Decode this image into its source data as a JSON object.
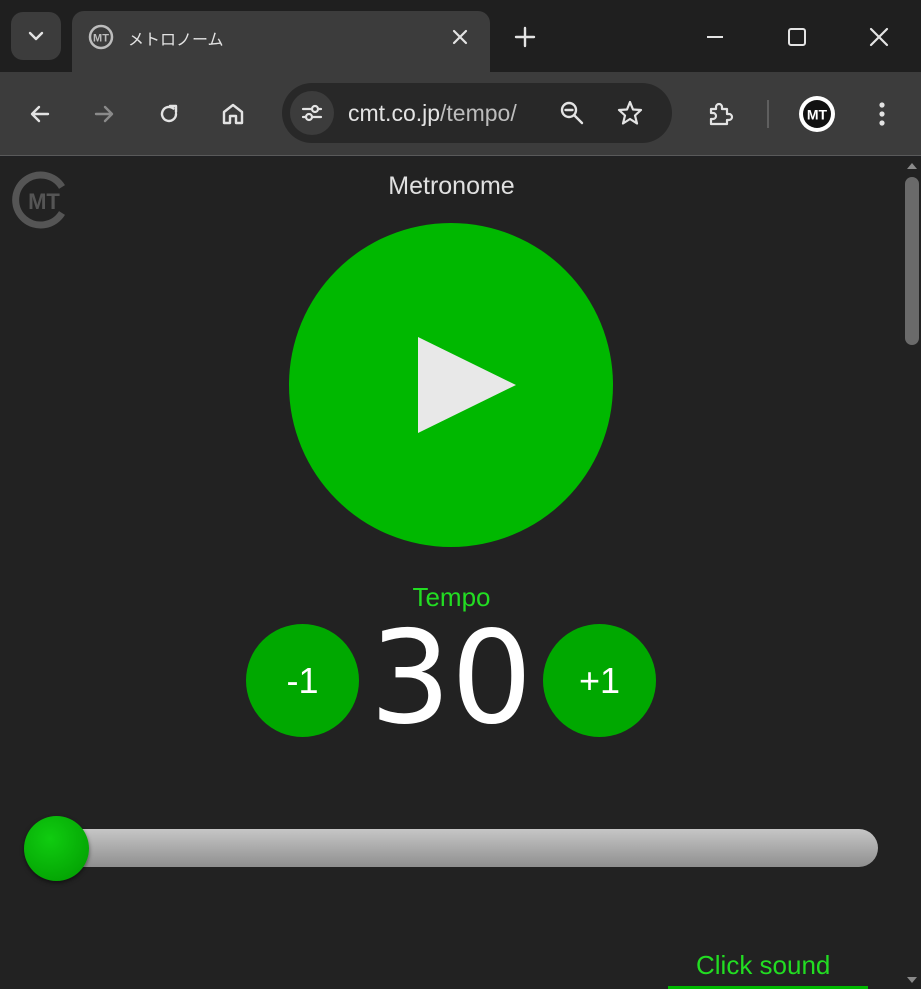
{
  "browser": {
    "tab": {
      "title": "メトロノーム",
      "close_glyph": "✕"
    },
    "new_tab_glyph": "+",
    "url": {
      "host": "cmt.co.jp",
      "path": "/tempo/"
    },
    "profile_initials": "MT",
    "icons": [
      "tab-search-icon",
      "back-icon",
      "forward-icon",
      "reload-icon",
      "home-icon",
      "site-info-icon",
      "zoom-icon",
      "bookmark-star-icon",
      "extensions-icon",
      "more-menu-icon",
      "minimize-icon",
      "maximize-icon",
      "close-window-icon"
    ]
  },
  "page": {
    "title": "Metronome",
    "logo_text": "MT",
    "tempo_label": "Tempo",
    "tempo_value": "30",
    "decrement_label": "-1",
    "increment_label": "+1",
    "slider_value": 30,
    "click_sound_label": "Click sound"
  },
  "colors": {
    "accent_green": "#00b800",
    "label_green": "#22dd22",
    "background": "#222222"
  }
}
